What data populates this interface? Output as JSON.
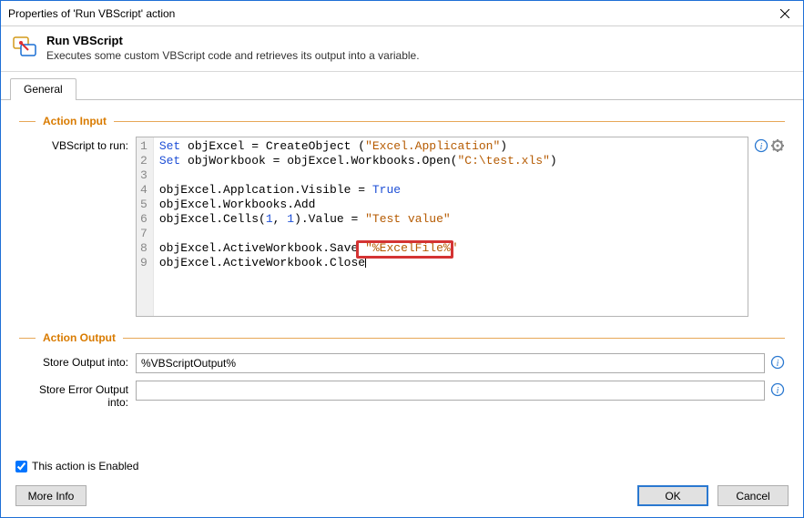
{
  "window": {
    "title": "Properties of 'Run VBScript' action"
  },
  "header": {
    "title": "Run VBScript",
    "subtitle": "Executes some custom VBScript code and retrieves its output into a variable."
  },
  "tabs": {
    "general": "General"
  },
  "groups": {
    "input_title": "Action Input",
    "output_title": "Action Output"
  },
  "labels": {
    "vbscript_to_run": "VBScript to run:",
    "store_output": "Store Output into:",
    "store_error": "Store Error Output into:"
  },
  "code": {
    "line1_a": "Set",
    "line1_b": " objExcel = CreateObject (",
    "line1_c": "\"Excel.Application\"",
    "line1_d": ")",
    "line2_a": "Set",
    "line2_b": " objWorkbook = objExcel.Workbooks.Open(",
    "line2_c": "\"C:\\test.xls\"",
    "line2_d": ")",
    "line3": "",
    "line4_a": "objExcel.Applcation.Visible = ",
    "line4_b": "True",
    "line5": "objExcel.Workbooks.Add",
    "line6_a": "objExcel.Cells(",
    "line6_b": "1",
    "line6_c": ", ",
    "line6_d": "1",
    "line6_e": ").Value = ",
    "line6_f": "\"Test value\"",
    "line7": "",
    "line8_a": "objExcel.ActiveWorkbook.Save ",
    "line8_b": "\"%ExcelFile%\"",
    "line9": "objExcel.ActiveWorkbook.Close",
    "gutter": [
      "1",
      "2",
      "3",
      "4",
      "5",
      "6",
      "7",
      "8",
      "9"
    ]
  },
  "outputs": {
    "store_output_value": "%VBScriptOutput%",
    "store_error_value": ""
  },
  "footer": {
    "enabled_label": "This action is Enabled",
    "more_info": "More Info",
    "ok": "OK",
    "cancel": "Cancel"
  }
}
